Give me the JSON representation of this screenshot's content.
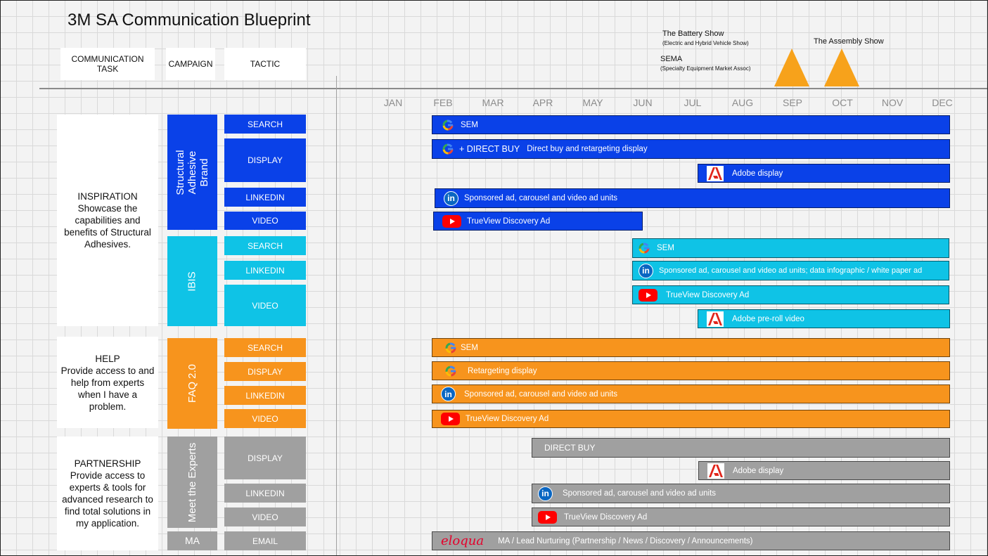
{
  "title": "3M SA Communication Blueprint",
  "headers": {
    "task": "COMMUNICATION TASK",
    "campaign": "CAMPAIGN",
    "tactic": "TACTIC"
  },
  "events": {
    "battery_show": "The Battery Show",
    "battery_show_sub": "(Electric and Hybrid Vehicle Show)",
    "sema": "SEMA",
    "sema_sub": "(Specialty Equipment Market Assoc)",
    "assembly_show": "The Assembly Show"
  },
  "months": [
    "JAN",
    "FEB",
    "MAR",
    "APR",
    "MAY",
    "JUN",
    "JUL",
    "AUG",
    "SEP",
    "OCT",
    "NOV",
    "DEC"
  ],
  "tasks": {
    "inspiration": "INSPIRATION\nShowcase the capabilities and benefits of Structural Adhesives.",
    "help": "HELP\nProvide access to and help from experts when I have a problem.",
    "partnership": "PARTNERSHIP\nProvide access to experts & tools for advanced research to find total solutions in my application."
  },
  "campaigns": {
    "sa_brand": "Structural Adhesive Brand",
    "ibis": "IBIS",
    "faq": "FAQ 2.0",
    "experts": "Meet the Experts",
    "ma": "MA"
  },
  "tactics": {
    "search": "SEARCH",
    "display": "DISPLAY",
    "linkedin": "LINKEDIN",
    "video": "VIDEO",
    "email": "EMAIL"
  },
  "bars": {
    "b1": "SEM",
    "b2_prefix": "+ DIRECT BUY",
    "b2": "Direct buy and retargeting display",
    "b3": "Adobe display",
    "b4": "Sponsored ad, carousel and video ad units",
    "b5": "TrueView Discovery Ad",
    "c1": "SEM",
    "c2": "Sponsored ad, carousel and video ad units; data infographic / white paper ad",
    "c3": "TrueView Discovery Ad",
    "c4": "Adobe pre-roll video",
    "o1": "SEM",
    "o2": "Retargeting display",
    "o3": "Sponsored ad, carousel and video ad units",
    "o4": "TrueView Discovery Ad",
    "g1": "DIRECT BUY",
    "g2": "Adobe display",
    "g3": "Sponsored ad, carousel and video ad units",
    "g4": "TrueView Discovery Ad",
    "g5": "MA / Lead Nurturing (Partnership / News / Discovery / Announcements)",
    "eloqua_logo": "eloqua"
  },
  "colors": {
    "blue": "#0a41e8",
    "cyan": "#0fc3e6",
    "orange": "#f7941d",
    "gray": "#a0a0a0",
    "triangle": "#f7a21b"
  }
}
